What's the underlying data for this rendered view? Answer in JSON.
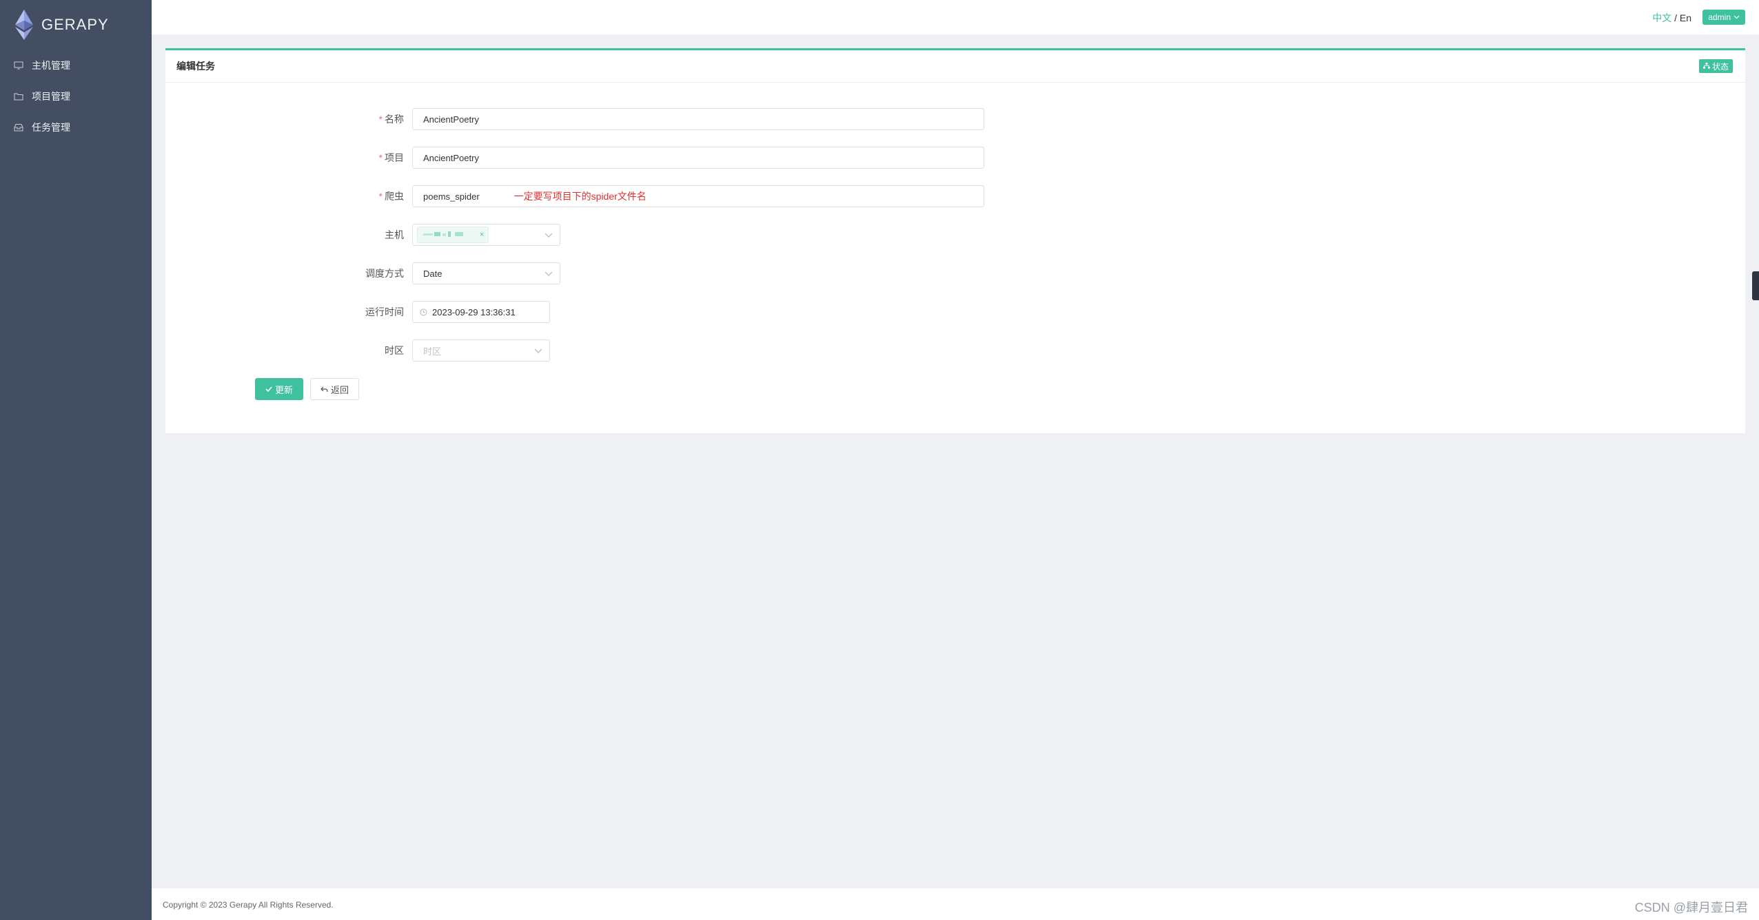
{
  "brand": {
    "name": "GERAPY"
  },
  "sidebar": {
    "items": [
      {
        "label": "主机管理",
        "icon": "monitor-icon"
      },
      {
        "label": "项目管理",
        "icon": "folder-icon"
      },
      {
        "label": "任务管理",
        "icon": "inbox-icon"
      }
    ]
  },
  "header": {
    "lang_zh": "中文",
    "lang_sep": " / ",
    "lang_en": "En",
    "user": "admin"
  },
  "panel": {
    "title": "编辑任务",
    "status_label": "状态"
  },
  "form": {
    "required_mark": "*",
    "name": {
      "label": "名称",
      "value": "AncientPoetry"
    },
    "project": {
      "label": "项目",
      "value": "AncientPoetry"
    },
    "spider": {
      "label": "爬虫",
      "value": "poems_spider",
      "note": "一定要写项目下的spider文件名"
    },
    "host": {
      "label": "主机",
      "tag_close": "×"
    },
    "schedule": {
      "label": "调度方式",
      "value": "Date"
    },
    "run_time": {
      "label": "运行时间",
      "value": "2023-09-29 13:36:31"
    },
    "timezone": {
      "label": "时区",
      "placeholder": "时区"
    },
    "update_button": "更新",
    "back_button": "返回"
  },
  "footer": {
    "copyright": "Copyright © 2023 Gerapy All Rights Reserved.",
    "watermark": "CSDN @肆月壹日君"
  },
  "colors": {
    "accent": "#3fc1a0",
    "sidebar_bg": "#434e62",
    "note_red": "#e03030",
    "required_red": "#f56c6c"
  }
}
